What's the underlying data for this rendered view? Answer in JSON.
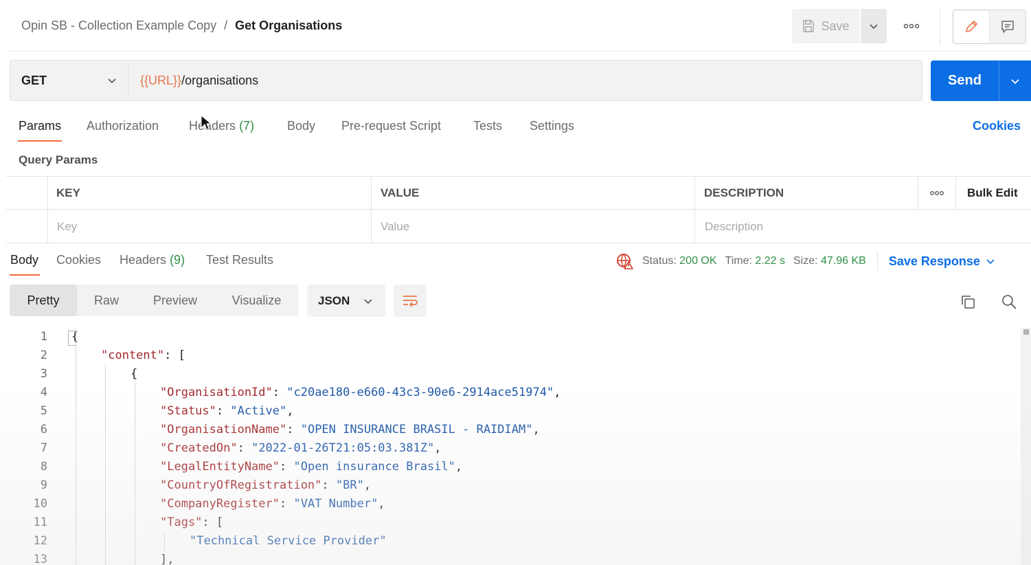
{
  "breadcrumb": {
    "parent": "Opin SB - Collection Example Copy",
    "separator": "/",
    "current": "Get Organisations"
  },
  "toolbar": {
    "save_label": "Save",
    "more_icon": "more-horizontal-icon",
    "edit_icon": "pencil-icon",
    "docs_icon": "comment-icon"
  },
  "request": {
    "method": "GET",
    "url_variable": "{{URL}}",
    "url_path": "/organisations",
    "send_label": "Send"
  },
  "request_tabs": [
    {
      "label": "Params",
      "count": ""
    },
    {
      "label": "Authorization",
      "count": ""
    },
    {
      "label": "Headers",
      "count": "(7)"
    },
    {
      "label": "Body",
      "count": ""
    },
    {
      "label": "Pre-request Script",
      "count": ""
    },
    {
      "label": "Tests",
      "count": ""
    },
    {
      "label": "Settings",
      "count": ""
    }
  ],
  "cookies_link": "Cookies",
  "query_params": {
    "title": "Query Params",
    "columns": [
      "KEY",
      "VALUE",
      "DESCRIPTION"
    ],
    "bulk_edit": "Bulk Edit",
    "placeholders": [
      "Key",
      "Value",
      "Description"
    ]
  },
  "response_tabs": [
    {
      "label": "Body",
      "count": ""
    },
    {
      "label": "Cookies",
      "count": ""
    },
    {
      "label": "Headers",
      "count": "(9)"
    },
    {
      "label": "Test Results",
      "count": ""
    }
  ],
  "response_status": {
    "status_label": "Status:",
    "status_value": "200 OK",
    "time_label": "Time:",
    "time_value": "2.22 s",
    "size_label": "Size:",
    "size_value": "47.96 KB",
    "save_response": "Save Response",
    "status_color": "#2f8f46"
  },
  "view_modes": [
    "Pretty",
    "Raw",
    "Preview",
    "Visualize"
  ],
  "active_view_mode": "Pretty",
  "language": "JSON",
  "colors": {
    "accent": "#0c6ee5",
    "tab_underline": "#f36c3d",
    "url_variable": "#e8764a",
    "json_key": "#a3282b",
    "json_string": "#1d57a8"
  },
  "code_lines": [
    {
      "n": "1",
      "key": "",
      "sep": "",
      "val": "",
      "tail": "{"
    },
    {
      "n": "2",
      "key": "\"content\"",
      "sep": ": ",
      "val": "",
      "tail": "["
    },
    {
      "n": "3",
      "key": "",
      "sep": "",
      "val": "",
      "tail": "{"
    },
    {
      "n": "4",
      "key": "\"OrganisationId\"",
      "sep": ": ",
      "val": "\"c20ae180-e660-43c3-90e6-2914ace51974\"",
      "tail": ","
    },
    {
      "n": "5",
      "key": "\"Status\"",
      "sep": ": ",
      "val": "\"Active\"",
      "tail": ","
    },
    {
      "n": "6",
      "key": "\"OrganisationName\"",
      "sep": ": ",
      "val": "\"OPEN INSURANCE BRASIL - RAIDIAM\"",
      "tail": ","
    },
    {
      "n": "7",
      "key": "\"CreatedOn\"",
      "sep": ": ",
      "val": "\"2022-01-26T21:05:03.381Z\"",
      "tail": ","
    },
    {
      "n": "8",
      "key": "\"LegalEntityName\"",
      "sep": ": ",
      "val": "\"Open insurance Brasil\"",
      "tail": ","
    },
    {
      "n": "9",
      "key": "\"CountryOfRegistration\"",
      "sep": ": ",
      "val": "\"BR\"",
      "tail": ","
    },
    {
      "n": "10",
      "key": "\"CompanyRegister\"",
      "sep": ": ",
      "val": "\"VAT Number\"",
      "tail": ","
    },
    {
      "n": "11",
      "key": "\"Tags\"",
      "sep": ": ",
      "val": "",
      "tail": "["
    },
    {
      "n": "12",
      "key": "",
      "sep": "",
      "val": "\"Technical Service Provider\"",
      "tail": ""
    },
    {
      "n": "13",
      "key": "",
      "sep": "",
      "val": "",
      "tail": "],"
    }
  ]
}
